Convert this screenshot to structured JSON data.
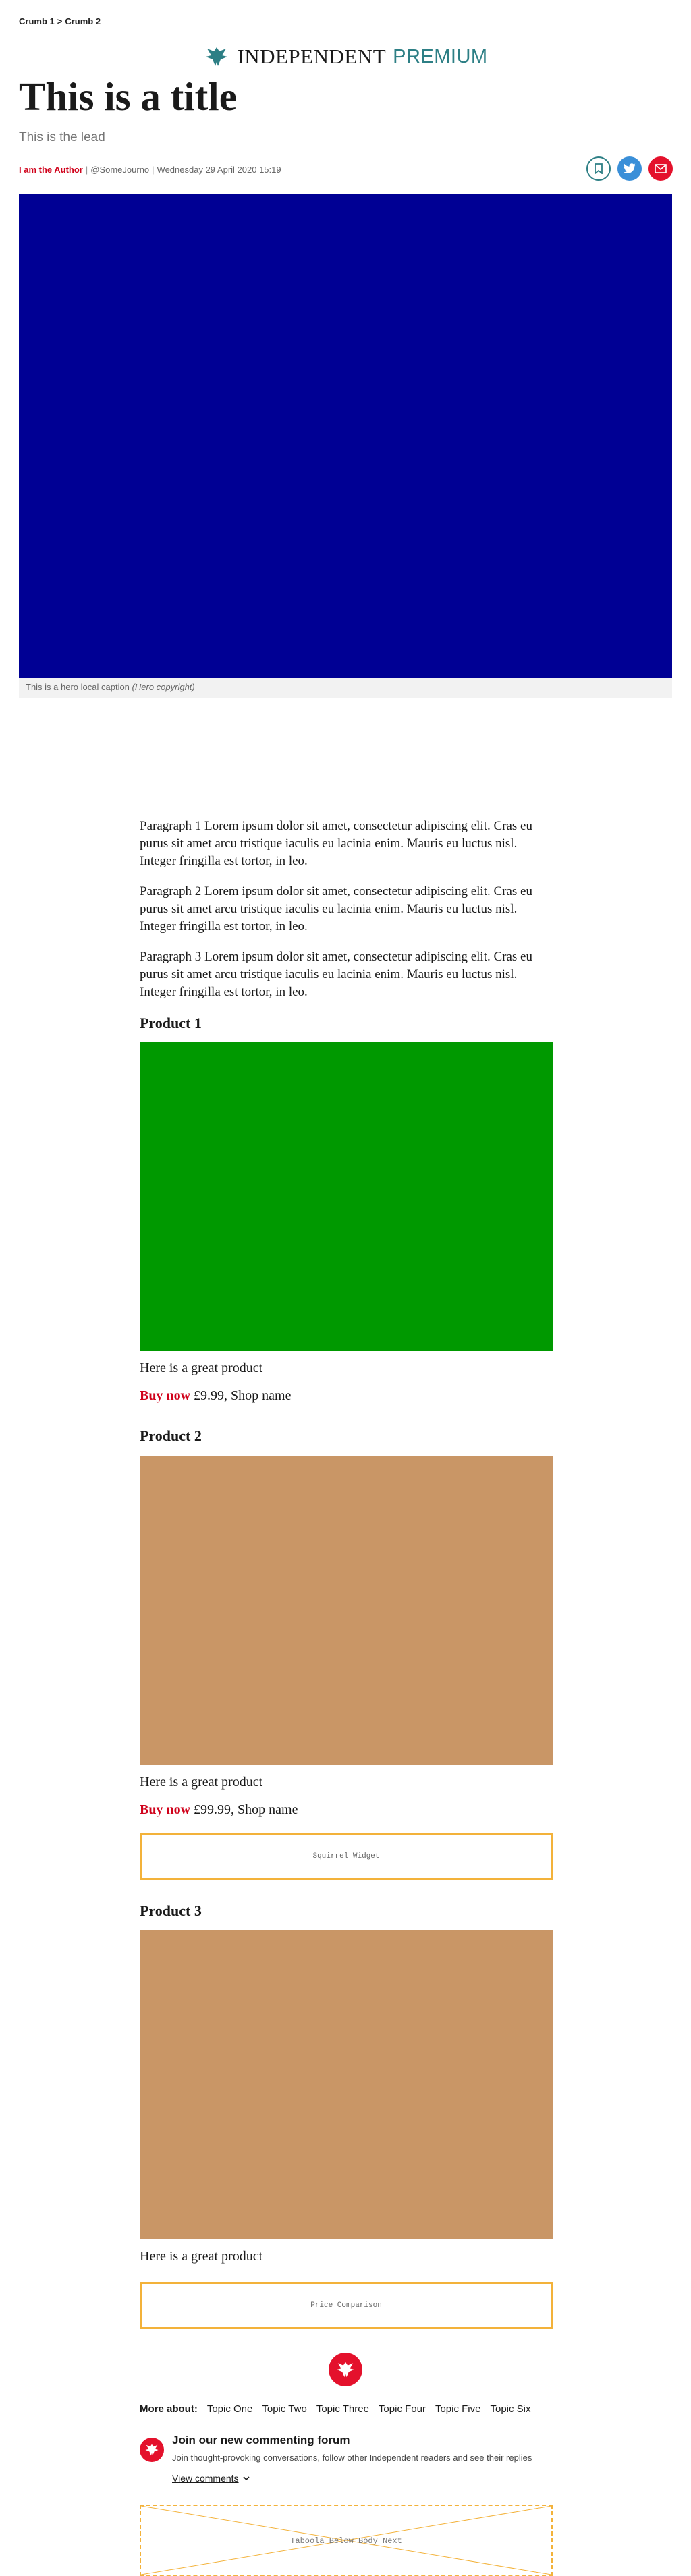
{
  "breadcrumb": {
    "crumb1": "Crumb 1",
    "sep": ">",
    "crumb2": "Crumb 2"
  },
  "masthead": {
    "brand": "INDEPENDENT",
    "premium": "PREMIUM"
  },
  "article": {
    "title": "This is a title",
    "lead": "This is the lead",
    "author": "I am the Author",
    "handle": "@SomeJourno",
    "date": "Wednesday 29 April 2020 15:19"
  },
  "share": {
    "bookmark_icon": "bookmark-icon",
    "twitter_icon": "twitter-icon",
    "email_icon": "email-icon"
  },
  "hero": {
    "color": "#000094",
    "caption": "This is a hero local caption",
    "copyright": "(Hero copyright)"
  },
  "paragraphs": [
    "Paragraph 1 Lorem ipsum dolor sit amet, consectetur adipiscing elit. Cras eu purus sit amet arcu tristique iaculis eu lacinia enim. Mauris eu luctus nisl. Integer fringilla est tortor, in leo.",
    "Paragraph 2 Lorem ipsum dolor sit amet, consectetur adipiscing elit. Cras eu purus sit amet arcu tristique iaculis eu lacinia enim. Mauris eu luctus nisl. Integer fringilla est tortor, in leo.",
    "Paragraph 3 Lorem ipsum dolor sit amet, consectetur adipiscing elit. Cras eu purus sit amet arcu tristique iaculis eu lacinia enim. Mauris eu luctus nisl. Integer fringilla est tortor, in leo."
  ],
  "products": [
    {
      "heading": "Product 1",
      "color": "#009900",
      "desc": "Here is a great product",
      "buy_label": "Buy now",
      "price_shop": "£9.99, Shop name"
    },
    {
      "heading": "Product 2",
      "color": "#c99666",
      "desc": "Here is a great product",
      "buy_label": "Buy now",
      "price_shop": "£99.99, Shop name"
    },
    {
      "heading": "Product 3",
      "color": "#c99666",
      "desc": "Here is a great product"
    }
  ],
  "widgets": {
    "squirrel": "Squirrel Widget",
    "price_comparison": "Price Comparison"
  },
  "more_about": {
    "label": "More about:",
    "topics": [
      "Topic One",
      "Topic Two",
      "Topic Three",
      "Topic Four",
      "Topic Five",
      "Topic Six"
    ]
  },
  "comments": {
    "title": "Join our new commenting forum",
    "subtitle": "Join thought-provoking conversations, follow other Independent readers and see their replies",
    "view": "View comments"
  },
  "taboola": {
    "label": "Taboola Below Body Next"
  },
  "colors": {
    "accent_red": "#d0021b",
    "teal": "#2d7f85",
    "widget_border": "#f3b23a"
  }
}
